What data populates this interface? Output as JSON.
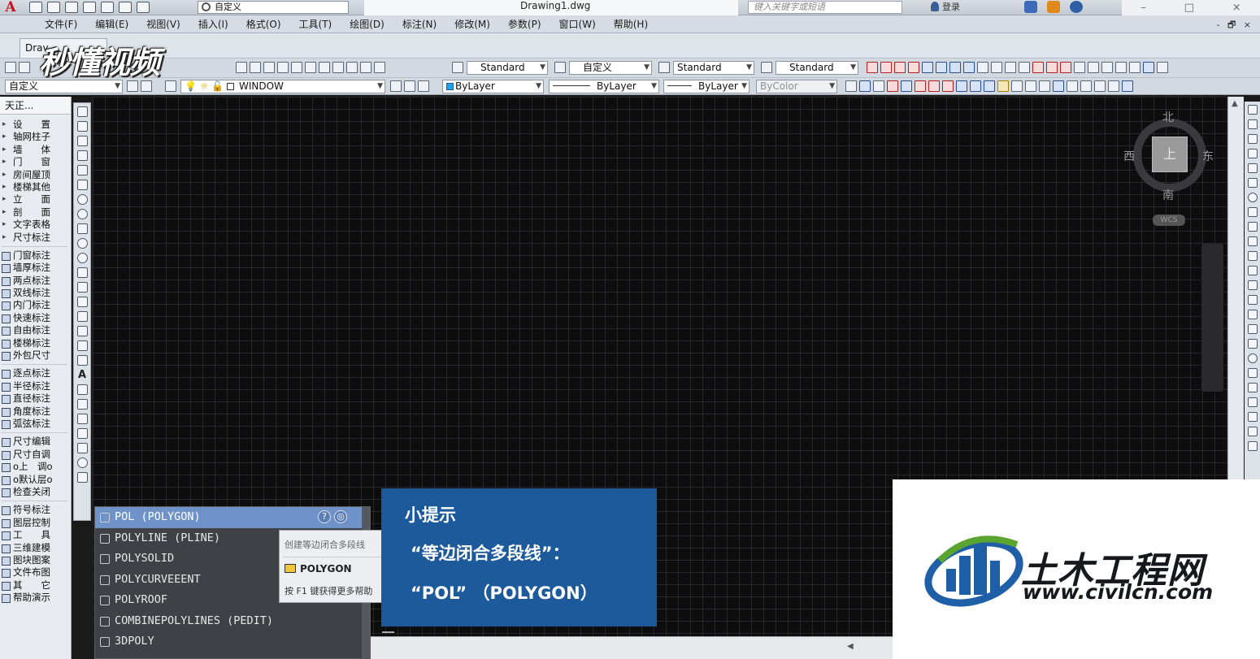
{
  "titlebar": {
    "workspace": "自定义",
    "document": "Drawing1.dwg",
    "search_placeholder": "键入关键字或短语",
    "login": "登录"
  },
  "menu": [
    "文件(F)",
    "编辑(E)",
    "视图(V)",
    "插入(I)",
    "格式(O)",
    "工具(T)",
    "绘图(D)",
    "标注(N)",
    "修改(M)",
    "参数(P)",
    "窗口(W)",
    "帮助(H)"
  ],
  "menu_right": "- 🗗 ×",
  "doc_tab": "Drav",
  "watermark": "秒懂视频",
  "toolbar2": {
    "text_style": "Standard",
    "dim_style": "自定义",
    "table_style": "Standard",
    "mleader_style": "Standard"
  },
  "toolbar3": {
    "named_view": "自定义",
    "layer": "WINDOW",
    "color": "ByLayer",
    "linetype": "ByLayer",
    "lineweight": "ByLayer",
    "plotstyle": "ByColor"
  },
  "left_panel": {
    "title": "天正...",
    "groups": [
      [
        "设　　置",
        "轴网柱子",
        "墙　　体",
        "门　　窗",
        "房间屋顶",
        "楼梯其他",
        "立　　面",
        "剖　　面",
        "文字表格",
        "尺寸标注"
      ],
      [
        "门窗标注",
        "墙厚标注",
        "两点标注",
        "双线标注",
        "内门标注",
        "快速标注",
        "自由标注",
        "楼梯标注",
        "外包尺寸"
      ],
      [
        "逐点标注",
        "半径标注",
        "直径标注",
        "角度标注",
        "弧弦标注"
      ],
      [
        "尺寸编辑",
        "尺寸自调",
        "o上　调o",
        "o默认层o",
        "检查关闭"
      ],
      [
        "符号标注",
        "图层控制",
        "工　　具",
        "三维建模",
        "图块图案",
        "文件布图",
        "其　　它",
        "帮助演示"
      ]
    ]
  },
  "viewcube": {
    "north": "北",
    "south": "南",
    "east": "东",
    "west": "西",
    "face": "上",
    "wcs": "WCS"
  },
  "autocomplete": {
    "items": [
      {
        "label": "POL (POLYGON)",
        "selected": true
      },
      {
        "label": "POLYLINE (PLINE)",
        "selected": false
      },
      {
        "label": "POLYSOLID",
        "selected": false
      },
      {
        "label": "POLYCURVEEENT",
        "selected": false
      },
      {
        "label": "POLYROOF",
        "selected": false
      },
      {
        "label": "COMBINEPOLYLINES (PEDIT)",
        "selected": false
      },
      {
        "label": "3DPOLY",
        "selected": false
      }
    ]
  },
  "tooltip": {
    "description": "创建等边闭合多段线",
    "command": "POLYGON",
    "help": "按 F1 键获得更多帮助"
  },
  "hint": {
    "title": "小提示",
    "line1": "“等边闭合多段线”：",
    "line2": "“POL” （POLYGON）"
  },
  "brand": {
    "name": "土木工程网",
    "url": "www.civilcn.com"
  },
  "colors": {
    "canvas": "#0d0d0e",
    "hint_box": "#1d5a9c",
    "autocomplete_selected": "#6f93c8",
    "logo_blue": "#1f5fa8",
    "logo_green": "#5aa52f"
  }
}
